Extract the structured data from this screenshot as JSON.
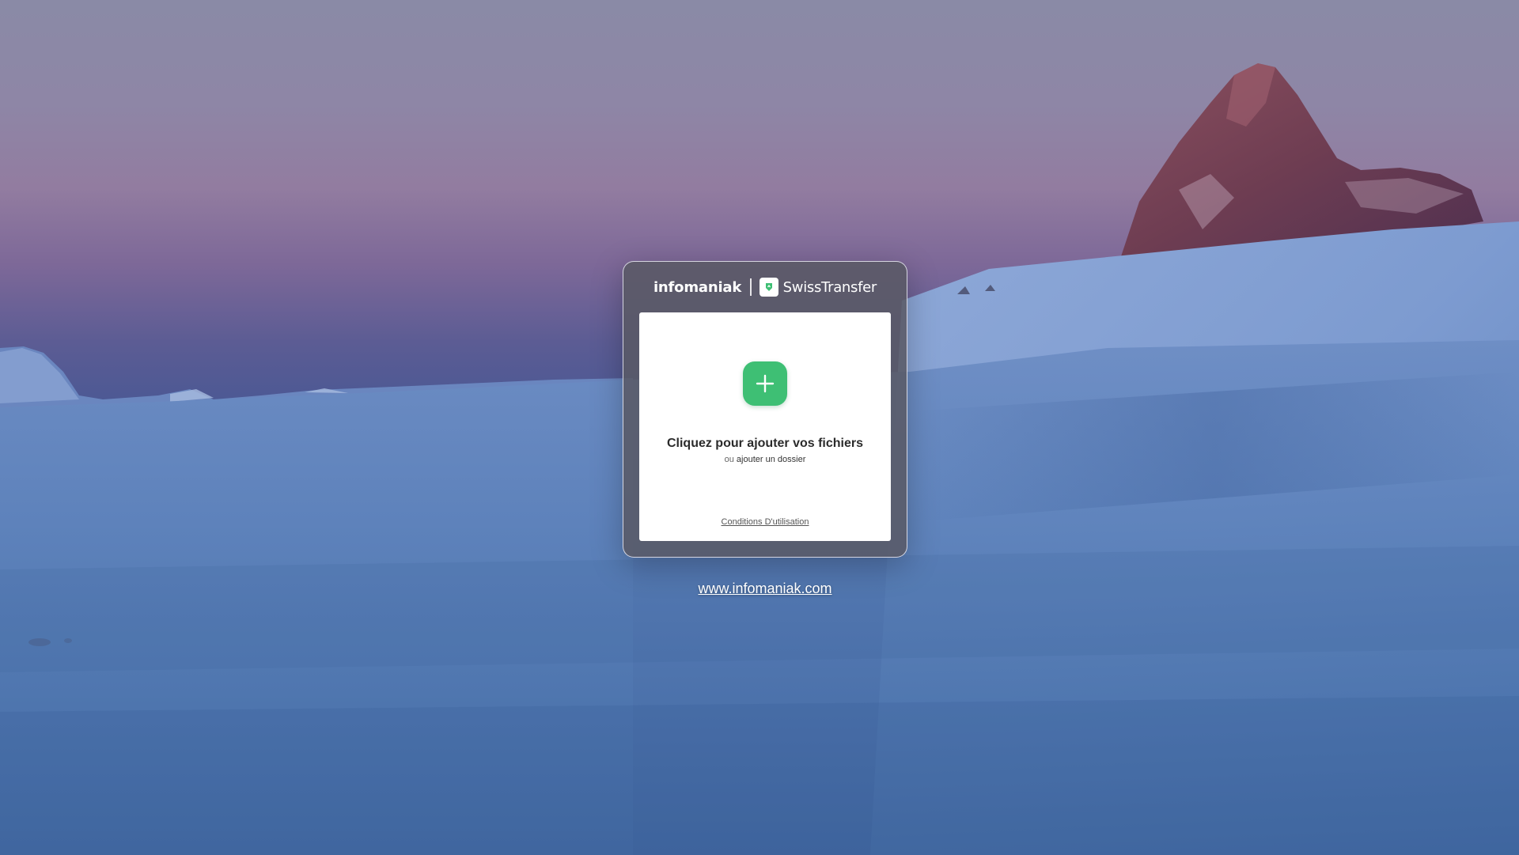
{
  "brand": {
    "company": "infomaniak",
    "product": "SwissTransfer",
    "logo_icon": "swisstransfer-logo-icon"
  },
  "upload": {
    "add_icon": "plus-icon",
    "title": "Cliquez pour ajouter vos fichiers",
    "or_text": "ou",
    "folder_link": "ajouter un dossier"
  },
  "footer": {
    "terms": "Conditions D'utilisation",
    "site": "www.infomaniak.com"
  },
  "colors": {
    "accent_green": "#3ebf74",
    "panel_bg": "#5a5a66",
    "card_bg": "#ffffff",
    "sky_top": "#8a86a4",
    "sky_mid": "#7a6c96",
    "snow": "#5e83b8"
  }
}
